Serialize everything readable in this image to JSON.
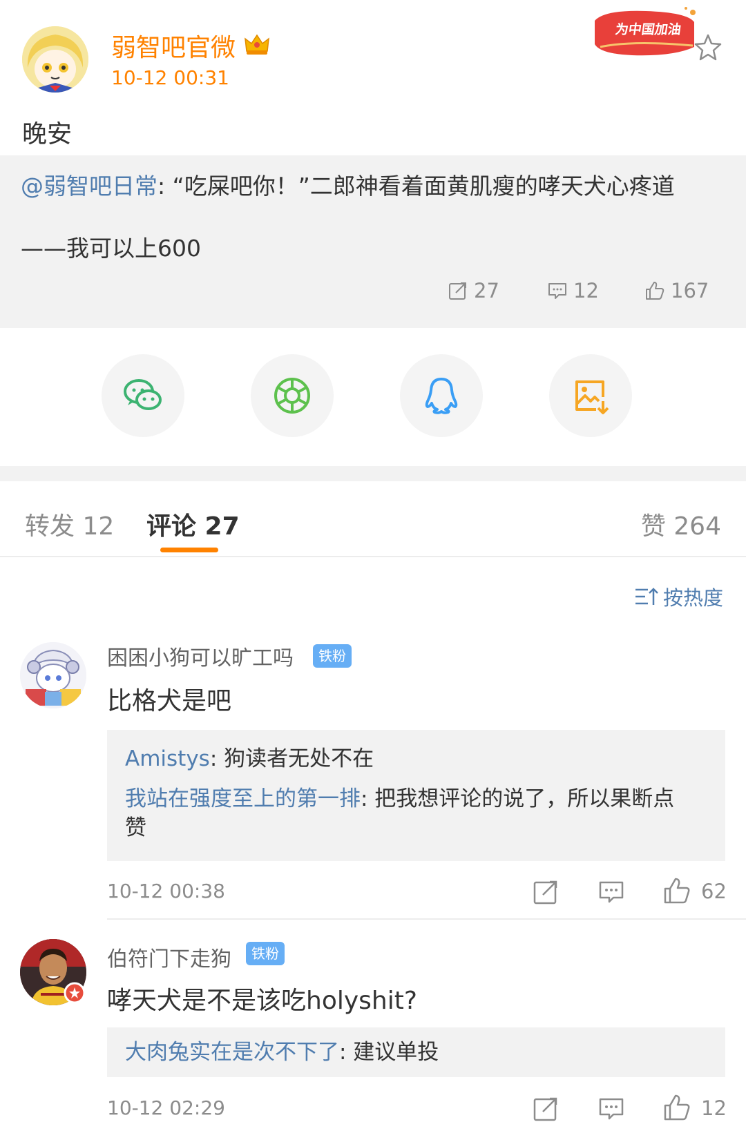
{
  "post": {
    "author": "弱智吧官微",
    "time": "10-12 00:31",
    "text": "晚安",
    "promo_badge": "为中国加油",
    "icons": {
      "verified": "crown-icon",
      "favorite": "star-icon"
    }
  },
  "repost": {
    "mention": "@弱智吧日常",
    "line1": ": “吃屎吧你！”二郎神看着面黄肌瘦的哮天犬心疼道",
    "line2": "——我可以上600",
    "reposts": "27",
    "comments": "12",
    "likes": "167"
  },
  "share": [
    {
      "name": "wechat",
      "icon": "wechat-icon",
      "color": "#3cb371"
    },
    {
      "name": "moments",
      "icon": "moments-icon",
      "color": "#5dc14d"
    },
    {
      "name": "qq",
      "icon": "qq-icon",
      "color": "#3a9ef5"
    },
    {
      "name": "save-image",
      "icon": "save-image-icon",
      "color": "#f6a623"
    }
  ],
  "tabs": [
    {
      "label": "转发 12"
    },
    {
      "label": "评论 27",
      "active": true
    },
    {
      "label": "赞 264"
    }
  ],
  "sort_label": "按热度",
  "comments": [
    {
      "user": "困困小狗可以旷工吗",
      "badge": "铁粉",
      "text": "比格犬是吧",
      "replies": [
        {
          "user": "Amistys",
          "text": ": 狗读者无处不在"
        },
        {
          "user": "我站在强度至上的第一排",
          "text": ": 把我想评论的说了，所以果断点",
          "text2": "赞"
        }
      ],
      "time": "10-12 00:38",
      "likes": "62"
    },
    {
      "user": "伯符门下走狗",
      "badge": "铁粉",
      "text": "哮天犬是不是该吃holyshit?",
      "replies": [
        {
          "user": "大肉兔实在是次不下了",
          "text": ": 建议单投"
        }
      ],
      "time": "10-12 02:29",
      "likes": "12"
    }
  ],
  "colors": {
    "accent": "#ff8200",
    "link": "#507daf",
    "muted": "#8c8c8c",
    "badge": "#66aef5",
    "panel": "#f2f2f2"
  }
}
